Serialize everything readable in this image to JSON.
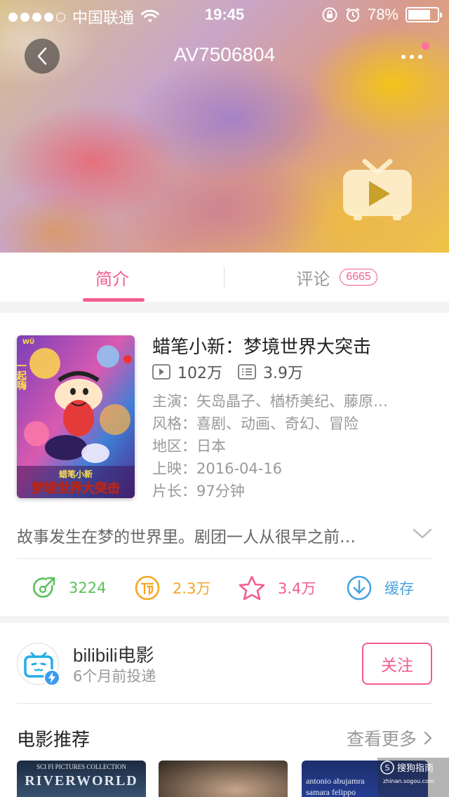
{
  "status_bar": {
    "carrier": "中国联通",
    "time": "19:45",
    "battery": "78%",
    "battery_level": 0.78,
    "signal_bars_filled": 4,
    "signal_bars_total": 5
  },
  "nav": {
    "title": "AV7506804",
    "back_icon": "chevron-left-icon",
    "more_icon": "more-dots-icon",
    "has_notification": true
  },
  "tabs": [
    {
      "label": "简介",
      "active": true
    },
    {
      "label": "评论",
      "count": "6665",
      "active": false
    }
  ],
  "video": {
    "title": "蜡笔小新：梦境世界大突击",
    "plays": "102万",
    "danmaku": "3.9万",
    "meta": [
      {
        "key": "主演：",
        "value": "矢岛晶子、楢桥美纪、藤原…"
      },
      {
        "key": "风格：",
        "value": "喜剧、动画、奇幻、冒险"
      },
      {
        "key": "地区：",
        "value": "日本"
      },
      {
        "key": "上映：",
        "value": "2016-04-16"
      },
      {
        "key": "片长：",
        "value": "97分钟"
      }
    ],
    "description": "故事发生在梦的世界里。剧团一人从很早之前…",
    "poster": {
      "top_corner": "一起嗨",
      "title": "梦境世界大突击",
      "logo": "蜡笔小新"
    }
  },
  "actions": [
    {
      "name": "share",
      "icon": "share-icon",
      "label": "3224",
      "color": "#59c15a"
    },
    {
      "name": "coin",
      "icon": "coin-icon",
      "label": "2.3万",
      "color": "#f5a623"
    },
    {
      "name": "favorite",
      "icon": "star-icon",
      "label": "3.4万",
      "color": "#f25d8e"
    },
    {
      "name": "download",
      "icon": "download-icon",
      "label": "缓存",
      "color": "#4aa3e0"
    }
  ],
  "uploader": {
    "name": "bilibili电影",
    "subtitle": "6个月前投递",
    "follow_label": "关注"
  },
  "recommend": {
    "title": "电影推荐",
    "more_label": "查看更多",
    "thumbs": [
      {
        "text_top": "SCI FI   PICTURES COLLECTION",
        "text_main": "RIVERWORLD"
      },
      {
        "text_top": "",
        "text_main": ""
      },
      {
        "text_top": "antonio abujamra",
        "text_main": "samara felippo"
      }
    ]
  },
  "watermark": {
    "line1": "搜狗指南",
    "line2": "zhinan.sogou.com"
  },
  "colors": {
    "accent": "#f25d8e",
    "gray_text": "#999999"
  }
}
